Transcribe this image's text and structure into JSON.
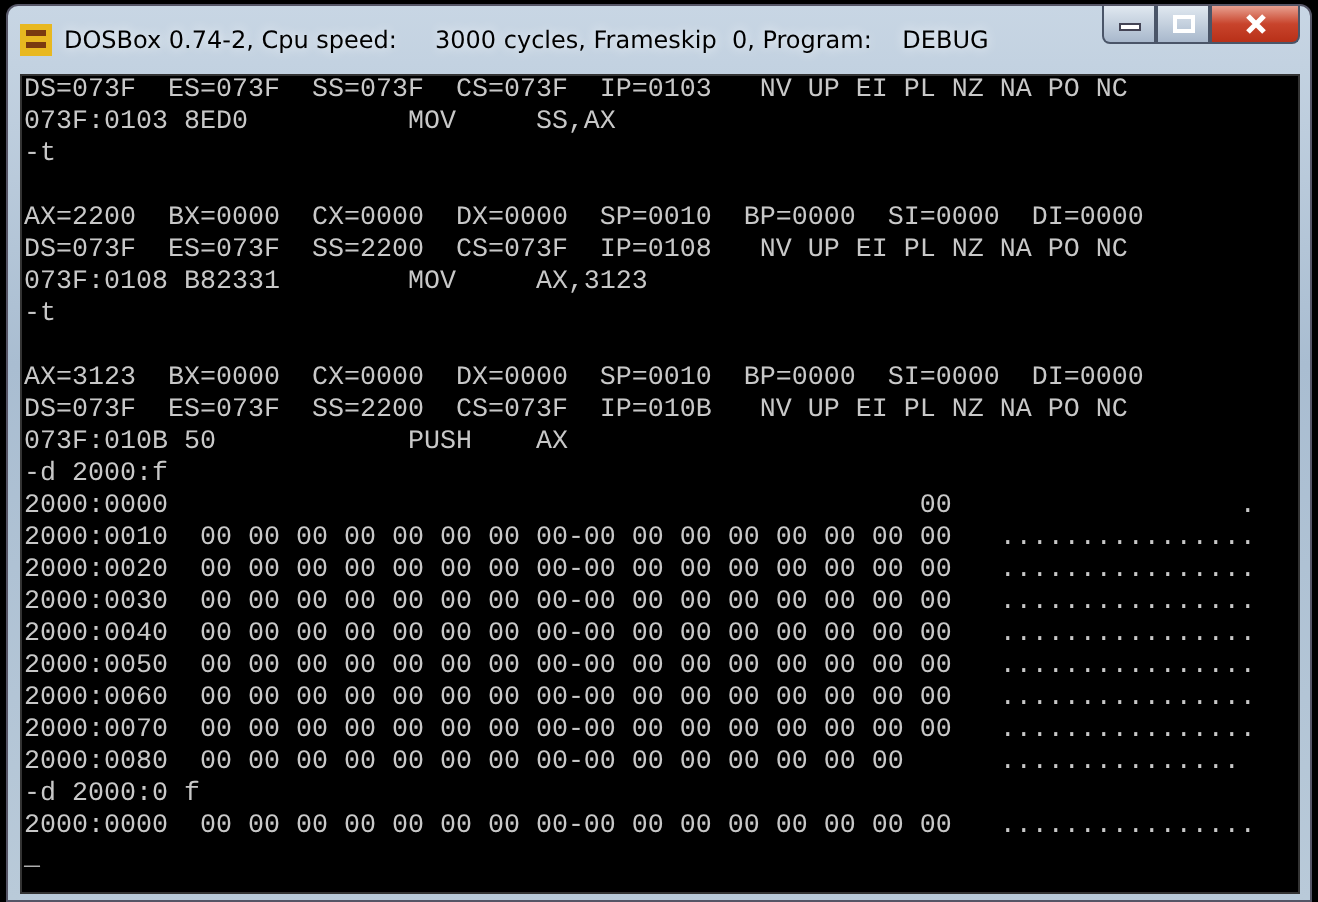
{
  "window": {
    "title": "DOSBox 0.74-2, Cpu speed:     3000 cycles, Frameskip  0, Program:    DEBUG",
    "controls": [
      {
        "kind": "minimize"
      },
      {
        "kind": "maximize"
      },
      {
        "kind": "close"
      }
    ]
  },
  "console": {
    "blocks": [
      [
        "DS=073F  ES=073F  SS=073F  CS=073F  IP=0103   NV UP EI PL NZ NA PO NC",
        "073F:0103 8ED0          MOV     SS,AX",
        "-t"
      ],
      [
        "AX=2200  BX=0000  CX=0000  DX=0000  SP=0010  BP=0000  SI=0000  DI=0000",
        "DS=073F  ES=073F  SS=2200  CS=073F  IP=0108   NV UP EI PL NZ NA PO NC",
        "073F:0108 B82331        MOV     AX,3123",
        "-t"
      ],
      [
        "AX=3123  BX=0000  CX=0000  DX=0000  SP=0010  BP=0000  SI=0000  DI=0000",
        "DS=073F  ES=073F  SS=2200  CS=073F  IP=010B   NV UP EI PL NZ NA PO NC",
        "073F:010B 50            PUSH    AX",
        "-d 2000:f",
        "2000:0000                                               00                  .",
        "2000:0010  00 00 00 00 00 00 00 00-00 00 00 00 00 00 00 00   ................",
        "2000:0020  00 00 00 00 00 00 00 00-00 00 00 00 00 00 00 00   ................",
        "2000:0030  00 00 00 00 00 00 00 00-00 00 00 00 00 00 00 00   ................",
        "2000:0040  00 00 00 00 00 00 00 00-00 00 00 00 00 00 00 00   ................",
        "2000:0050  00 00 00 00 00 00 00 00-00 00 00 00 00 00 00 00   ................",
        "2000:0060  00 00 00 00 00 00 00 00-00 00 00 00 00 00 00 00   ................",
        "2000:0070  00 00 00 00 00 00 00 00-00 00 00 00 00 00 00 00   ................",
        "2000:0080  00 00 00 00 00 00 00 00-00 00 00 00 00 00 00      ...............",
        "-d 2000:0 f",
        "2000:0000  00 00 00 00 00 00 00 00-00 00 00 00 00 00 00 00   ................",
        "_"
      ]
    ]
  }
}
